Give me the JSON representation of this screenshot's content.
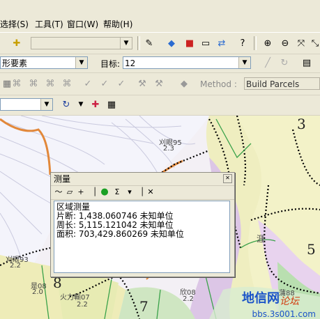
{
  "menu": {
    "select": "选择(S)",
    "tools": "工具(T)",
    "window": "窗口(W)",
    "help": "帮助(H)"
  },
  "toolbar2": {
    "layer_value": "形要素",
    "target_label": "目标:",
    "target_value": "12"
  },
  "toolbar3": {
    "method_label": "Method :",
    "method_value": "Build Parcels"
  },
  "measure": {
    "title": "测量",
    "close": "✕",
    "heading": "区域测量",
    "segment": "片断: 1,438.060746 未知单位",
    "perimeter": "周长: 5,115.121042 未知单位",
    "area": "面积: 703,429.860269 未知单位"
  },
  "map": {
    "labels": {
      "l1": "刈眼95",
      "l2": "2.3",
      "l3": "刈眼93",
      "l4": "2.2",
      "l5": "是08",
      "l6": "2.0",
      "l7": "火力輸07",
      "l8": "2.2",
      "l9": "欣08",
      "l10": "2.2",
      "l11": "涯",
      "l12": "蒲88"
    },
    "numbers": {
      "n3": "3",
      "n5": "5",
      "n7": "7",
      "n8": "8"
    }
  },
  "watermark": {
    "brand": "地信网",
    "cn": "论坛",
    "url": "bbs.3s001.com"
  }
}
